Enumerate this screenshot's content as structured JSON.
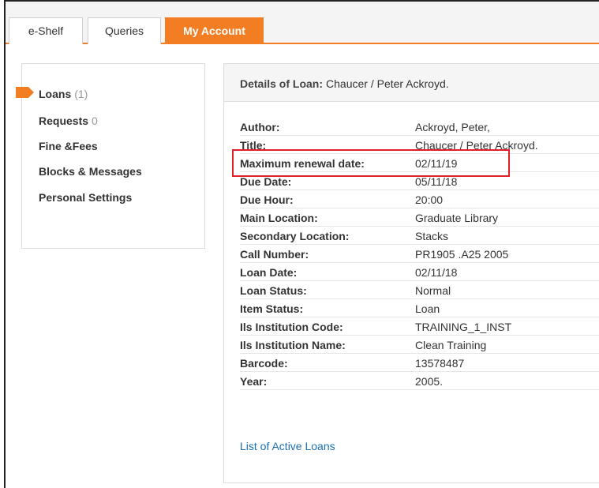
{
  "tabs": [
    {
      "label": "e-Shelf",
      "active": false
    },
    {
      "label": "Queries",
      "active": false
    },
    {
      "label": "My Account",
      "active": true
    }
  ],
  "sidebar": {
    "items": [
      {
        "label": "Loans",
        "count": "(1)",
        "active": true
      },
      {
        "label": "Requests",
        "count": "0"
      },
      {
        "label": "Fine &Fees"
      },
      {
        "label": "Blocks & Messages"
      },
      {
        "label": "Personal Settings"
      }
    ]
  },
  "details": {
    "header_label": "Details of Loan:",
    "header_value": "Chaucer / Peter Ackroyd.",
    "fields": [
      {
        "label": "Author:",
        "value": "Ackroyd, Peter,"
      },
      {
        "label": "Title:",
        "value": "Chaucer / Peter Ackroyd."
      },
      {
        "label": "Maximum renewal date:",
        "value": "02/11/19"
      },
      {
        "label": "Due Date:",
        "value": "05/11/18"
      },
      {
        "label": "Due Hour:",
        "value": "20:00"
      },
      {
        "label": "Main Location:",
        "value": "Graduate Library"
      },
      {
        "label": "Secondary Location:",
        "value": "Stacks"
      },
      {
        "label": "Call Number:",
        "value": "PR1905 .A25 2005"
      },
      {
        "label": "Loan Date:",
        "value": "02/11/18"
      },
      {
        "label": "Loan Status:",
        "value": "Normal"
      },
      {
        "label": "Item Status:",
        "value": "Loan"
      },
      {
        "label": "Ils Institution Code:",
        "value": "TRAINING_1_INST"
      },
      {
        "label": "Ils Institution Name:",
        "value": "Clean Training"
      },
      {
        "label": "Barcode:",
        "value": "13578487"
      },
      {
        "label": "Year:",
        "value": "2005."
      }
    ],
    "link": "List of Active Loans"
  },
  "colors": {
    "accent": "#f27d22",
    "link": "#1a6fb5",
    "highlight": "#e0202a"
  },
  "icons": {
    "active_marker": "tag-arrow-icon"
  }
}
